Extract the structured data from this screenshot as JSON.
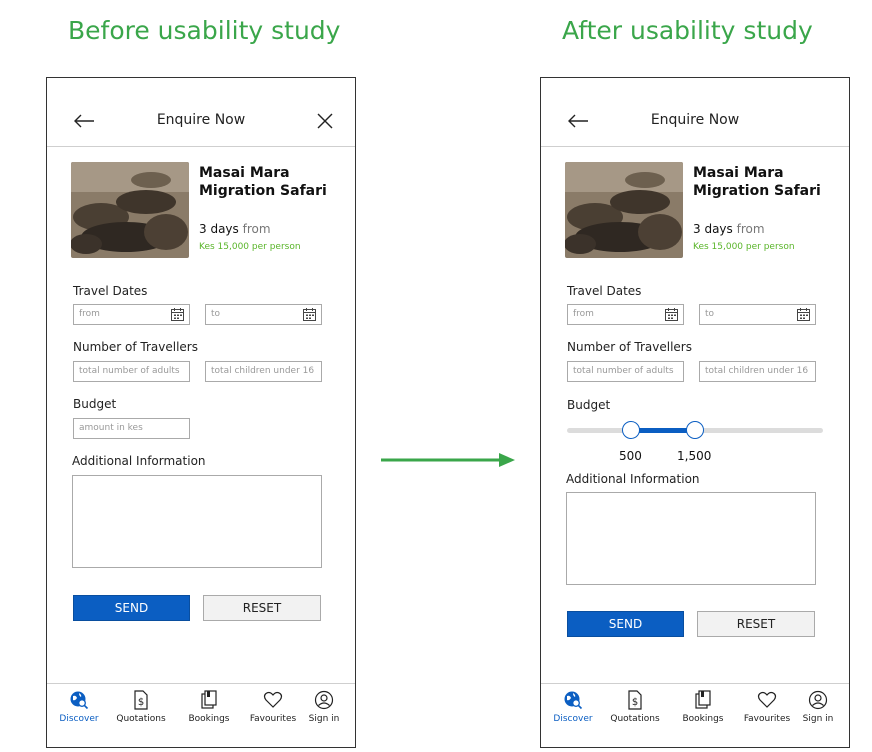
{
  "headings": {
    "before": "Before usability study",
    "after": "After usability study"
  },
  "header": {
    "title": "Enquire Now"
  },
  "trip": {
    "title": "Masai Mara Migration Safari",
    "days": "3 days",
    "from": "from",
    "price": "Kes 15,000 per person"
  },
  "form": {
    "travel_dates_label": "Travel Dates",
    "from_placeholder": "from",
    "to_placeholder": "to",
    "travellers_label": "Number of Travellers",
    "adults_placeholder": "total number of adults",
    "children_placeholder": "total children under 16",
    "budget_label": "Budget",
    "budget_placeholder": "amount in kes",
    "additional_label": "Additional Information",
    "send": "SEND",
    "reset": "RESET"
  },
  "slider": {
    "min_value": "500",
    "max_value": "1,500",
    "fill_start": 0.25,
    "fill_end": 0.5
  },
  "nav": [
    {
      "label": "Discover",
      "icon": "globe-search-icon",
      "active": true
    },
    {
      "label": "Quotations",
      "icon": "document-dollar-icon",
      "active": false
    },
    {
      "label": "Bookings",
      "icon": "bookings-icon",
      "active": false
    },
    {
      "label": "Favourites",
      "icon": "heart-icon",
      "active": false
    },
    {
      "label": "Sign in",
      "icon": "user-circle-icon",
      "active": false
    }
  ],
  "colors": {
    "accent_green": "#3aa64a",
    "primary_blue": "#0b5ec2",
    "price_green": "#5ab52a"
  }
}
